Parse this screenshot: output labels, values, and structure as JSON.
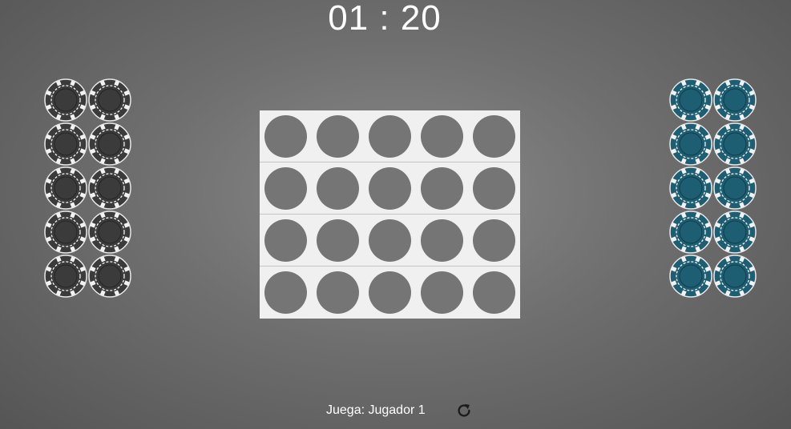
{
  "timer": {
    "minutes": "01",
    "separator": " : ",
    "seconds": "20",
    "display": "01 : 20"
  },
  "players": [
    {
      "id": "player-1",
      "chip_color": "#3b3b3b",
      "chips_remaining": 10
    },
    {
      "id": "player-2",
      "chip_color": "#1d5e72",
      "chips_remaining": 10
    }
  ],
  "board": {
    "rows": 4,
    "columns": 5,
    "background": "#f0f0f0",
    "empty_cell_color": "#757575"
  },
  "status": {
    "turn_text": "Juega: Jugador 1"
  },
  "controls": {
    "restart_icon": "restart-icon"
  }
}
